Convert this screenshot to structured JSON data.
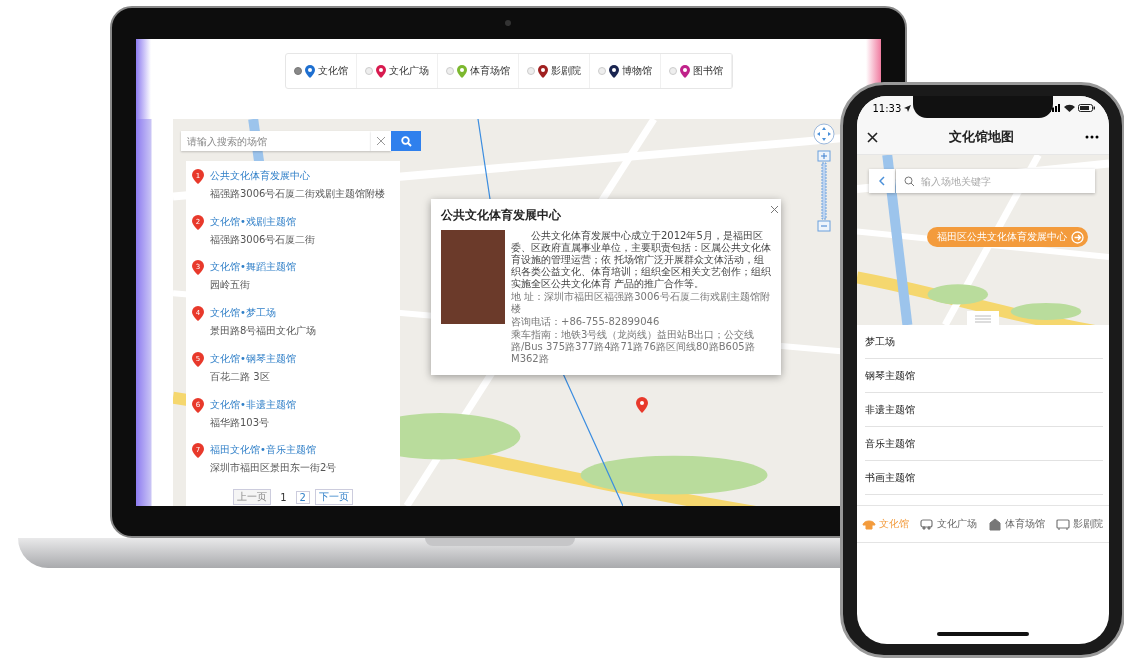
{
  "laptop": {
    "filters": [
      {
        "label": "文化馆",
        "selected": true,
        "color": "#1e6fd0"
      },
      {
        "label": "文化广场",
        "selected": false,
        "color": "#d81b4f"
      },
      {
        "label": "体育场馆",
        "selected": false,
        "color": "#7cb82f"
      },
      {
        "label": "影剧院",
        "selected": false,
        "color": "#a02020"
      },
      {
        "label": "博物馆",
        "selected": false,
        "color": "#1a2550"
      },
      {
        "label": "图书馆",
        "selected": false,
        "color": "#c0228a"
      }
    ],
    "search": {
      "placeholder": "请输入搜索的场馆"
    },
    "results": [
      {
        "number": "1",
        "name": "公共文化体育发展中心",
        "address": "福强路3006号石厦二街戏剧主题馆附楼"
      },
      {
        "number": "2",
        "name": "文化馆•戏剧主题馆",
        "address": "福强路3006号石厦二街"
      },
      {
        "number": "3",
        "name": "文化馆•舞蹈主题馆",
        "address": "园岭五街"
      },
      {
        "number": "4",
        "name": "文化馆•梦工场",
        "address": "景田路8号福田文化广场"
      },
      {
        "number": "5",
        "name": "文化馆•钢琴主题馆",
        "address": "百花二路 3区"
      },
      {
        "number": "6",
        "name": "文化馆•非遗主题馆",
        "address": "福华路103号"
      },
      {
        "number": "7",
        "name": "福田文化馆•音乐主题馆",
        "address": "深圳市福田区景田东一街2号"
      }
    ],
    "pagination": {
      "prev": "上一页",
      "pages": [
        {
          "label": "1",
          "selected": true
        },
        {
          "label": "2",
          "selected": false
        }
      ],
      "next": "下一页"
    },
    "popup": {
      "title": "公共文化体育发展中心",
      "description": "公共文化体育发展中心成立于2012年5月，是福田区委、区政府直属事业单位，主要职责包括：区属公共文化体育设施的管理运营；依 托场馆广泛开展群众文体活动，组织各类公益文化、体育培训；组织全区相关文艺创作；组织实施全区公共文化体育 产品的推广合作等。",
      "details": [
        "地 址：深圳市福田区福强路3006号石厦二街戏剧主题馆附楼",
        "咨询电话：+86-755-82899046",
        "乘车指南：地铁3号线（龙岗线）益田站B出口；公交线路/Bus 375路377路4路71路76路区间线80路B605路M362路"
      ]
    }
  },
  "phone": {
    "time": "11:33",
    "title": "文化馆地图",
    "search": {
      "placeholder": "输入场地关键字"
    },
    "callout": "福田区公共文化体育发展中心",
    "list": [
      "梦工场",
      "钢琴主题馆",
      "非遗主题馆",
      "音乐主题馆",
      "书画主题馆"
    ],
    "tabs": [
      {
        "label": "文化馆",
        "selected": true
      },
      {
        "label": "文化广场",
        "selected": false
      },
      {
        "label": "体育场馆",
        "selected": false
      },
      {
        "label": "影剧院",
        "selected": false
      }
    ]
  }
}
